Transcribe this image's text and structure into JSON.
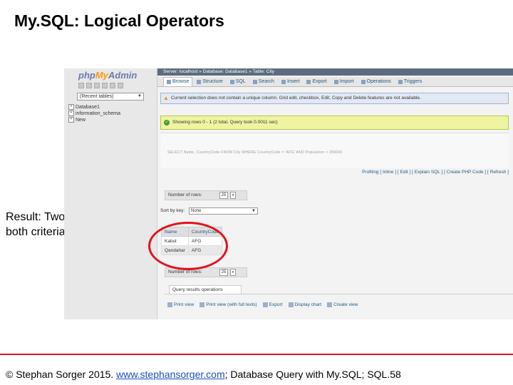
{
  "slide": {
    "title": "My.SQL: Logical Operators",
    "result_note": "Result: Two cities met both criteria",
    "footer": {
      "prefix": "© Stephan Sorger 2015. ",
      "link": "www.stephansorger.com",
      "suffix": "; Database Query with My.SQL; SQL.58"
    }
  },
  "phpmyadmin": {
    "logo_php": "php",
    "logo_my": "My",
    "logo_admin": "Admin",
    "db_select": "(Recent tables)",
    "tree": [
      "Database1",
      "information_schema",
      "New"
    ],
    "breadcrumb": "Server: localhost » Database: Database1 » Table: City",
    "tabs": [
      "Browse",
      "Structure",
      "SQL",
      "Search",
      "Insert",
      "Export",
      "Import",
      "Operations",
      "Triggers"
    ],
    "notice": "Current selection does not contain a unique column. Grid edit, checkbox, Edit, Copy and Delete features are not available.",
    "success": "Showing rows 0 - 1 (2 total, Query took 0.0011 sec)",
    "sql_text": "SELECT Name, CountryCode FROM City WHERE CountryCode = 'AFG' AND Population > 200000",
    "sql_actions": "Profiling [ Inline ] [ Edit ] [ Explain SQL ] [ Create PHP Code ] [ Refresh ]",
    "rows_label": "Number of rows:",
    "rows_value": "25",
    "sort_label": "Sort by key:",
    "sort_value": "None",
    "table": {
      "headers": [
        "Name",
        "CountryCode"
      ],
      "rows": [
        [
          "Kabul",
          "AFG"
        ],
        [
          "Qandahar",
          "AFG"
        ]
      ]
    },
    "qro_title": "Query results operations",
    "qro_actions": [
      "Print view",
      "Print view (with full texts)",
      "Export",
      "Display chart",
      "Create view"
    ]
  },
  "colors": {
    "accent_red": "#e0141e",
    "link_blue": "#235a81",
    "success_bg": "#eef4a0"
  }
}
